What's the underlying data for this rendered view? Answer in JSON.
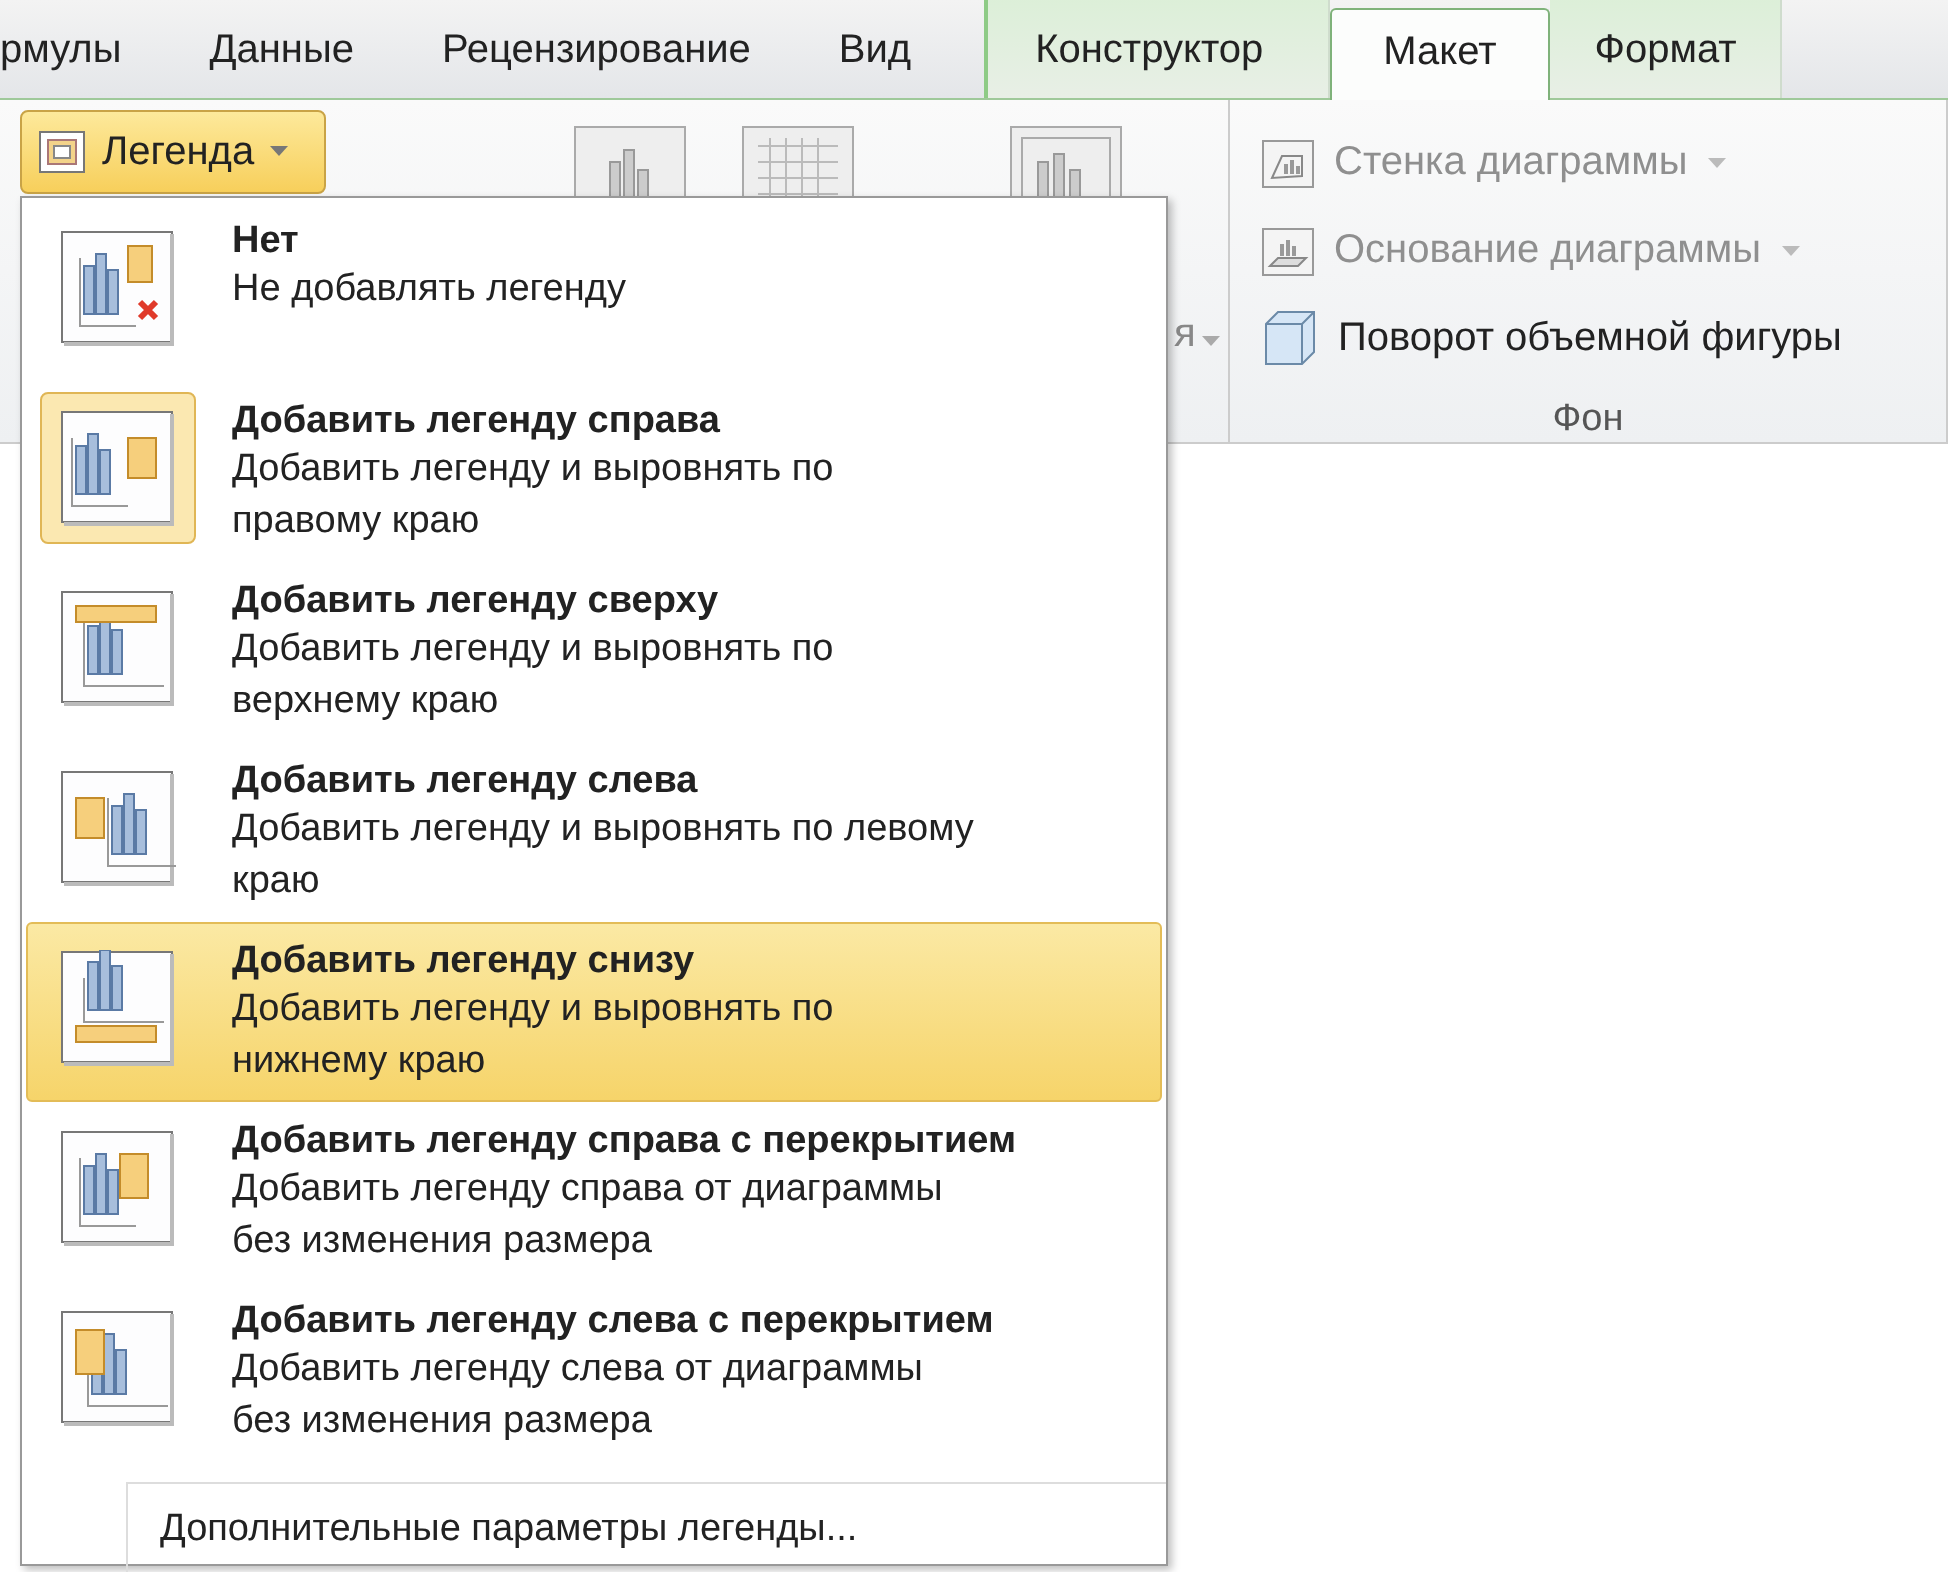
{
  "tabs": [
    {
      "label": "рмулы",
      "selected": false,
      "contextual": false
    },
    {
      "label": "Данные",
      "selected": false,
      "contextual": false
    },
    {
      "label": "Рецензирование",
      "selected": false,
      "contextual": false
    },
    {
      "label": "Вид",
      "selected": false,
      "contextual": false
    },
    {
      "label": "Конструктор",
      "selected": false,
      "contextual": true
    },
    {
      "label": "Макет",
      "selected": true,
      "contextual": true
    },
    {
      "label": "Формат",
      "selected": false,
      "contextual": true
    }
  ],
  "legend_button": {
    "label": "Легенда",
    "pressed": true
  },
  "partial_label": "я",
  "background_group": {
    "label": "Фон",
    "items": [
      {
        "label": "Стенка диаграммы",
        "disabled": true,
        "dropdown": true,
        "kind": "wall"
      },
      {
        "label": "Основание диаграммы",
        "disabled": true,
        "dropdown": true,
        "kind": "floor"
      },
      {
        "label": "Поворот объемной фигуры",
        "disabled": false,
        "dropdown": false,
        "kind": "cube"
      }
    ]
  },
  "menu": {
    "items": [
      {
        "kind": "none",
        "title": "Нет",
        "description": "Не добавлять легенду",
        "checked": false,
        "hovered": false
      },
      {
        "kind": "right",
        "title": "Добавить легенду справа",
        "description": "Добавить легенду и выровнять по правому краю",
        "checked": true,
        "hovered": false
      },
      {
        "kind": "top",
        "title": "Добавить легенду сверху",
        "description": "Добавить легенду и выровнять по верхнему краю",
        "checked": false,
        "hovered": false
      },
      {
        "kind": "left",
        "title": "Добавить легенду слева",
        "description": "Добавить легенду и выровнять по левому краю",
        "checked": false,
        "hovered": false
      },
      {
        "kind": "bottom",
        "title": "Добавить легенду снизу",
        "description": "Добавить легенду и выровнять по нижнему краю",
        "checked": false,
        "hovered": true
      },
      {
        "kind": "overlay-right",
        "title": "Добавить легенду справа с перекрытием",
        "description": "Добавить легенду справа от диаграммы без изменения размера",
        "checked": false,
        "hovered": false
      },
      {
        "kind": "overlay-left",
        "title": "Добавить легенду слева с перекрытием",
        "description": "Добавить легенду слева от диаграммы без изменения размера",
        "checked": false,
        "hovered": false
      }
    ],
    "footer": "Дополнительные параметры легенды..."
  }
}
